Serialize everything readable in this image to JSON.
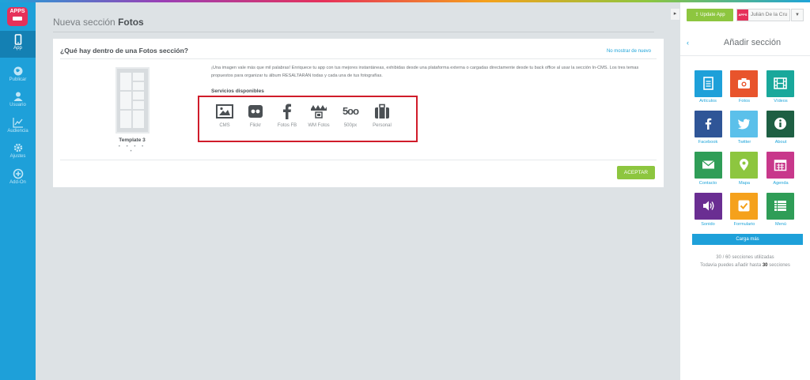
{
  "app": {
    "logo_text": "APPS",
    "accent": "#1ea0d9"
  },
  "sidebar": {
    "items": [
      {
        "label": "App",
        "icon": "mobile-icon"
      },
      {
        "label": "Publicar",
        "icon": "globe-icon"
      },
      {
        "label": "Usuario",
        "icon": "user-icon"
      },
      {
        "label": "Audiencia",
        "icon": "chart-icon"
      },
      {
        "label": "Ajustes",
        "icon": "gear-icon"
      },
      {
        "label": "Add-On",
        "icon": "plus-circle-icon"
      }
    ]
  },
  "main": {
    "title_prefix": "Nueva sección",
    "title_bold": "Fotos"
  },
  "card": {
    "title": "¿Qué hay dentro de una Fotos sección?",
    "dismiss_link": "No mostrar de nuevo",
    "template_label": "Template 3",
    "template_dots": "• • • • •",
    "description": "¡Una imagen vale más que mil palabras! Enriquece tu app con tus mejores instantáneas, exhibidas desde una plataforma externa o cargadas directamente desde tu back office al usar la sección In-CMS. Los tres temas propuestos para organizar tu álbum RESALTARÁN todas y cada una de tus fotografías.",
    "services_title": "Servicios disponibles",
    "services": [
      {
        "label": "CMS",
        "icon": "image-icon"
      },
      {
        "label": "Flickr",
        "icon": "flickr-icon"
      },
      {
        "label": "Fotos FB",
        "icon": "facebook-icon"
      },
      {
        "label": "WM Fotos",
        "icon": "wm-fotos-icon"
      },
      {
        "label": "500px",
        "icon": "500px-icon",
        "glyph": "5oo"
      },
      {
        "label": "Personal",
        "icon": "briefcase-icon"
      }
    ],
    "accept_label": "ACEPTAR",
    "highlight_color": "#d01c2a"
  },
  "right_panel": {
    "update_label": "Update App",
    "user_name": "Julián De la Cru",
    "avatar_text": "APPS",
    "title": "Añadir sección",
    "tiles": [
      {
        "label": "Artículos",
        "color": "#1ea0d9",
        "icon": "document-icon"
      },
      {
        "label": "Fotos",
        "color": "#e8542c",
        "icon": "camera-icon"
      },
      {
        "label": "Vídeos",
        "color": "#19a89b",
        "icon": "film-icon"
      },
      {
        "label": "Facebook",
        "color": "#2f5597",
        "icon": "facebook-icon"
      },
      {
        "label": "Twitter",
        "color": "#5bc0ea",
        "icon": "twitter-icon"
      },
      {
        "label": "About",
        "color": "#1e5f43",
        "icon": "info-icon"
      },
      {
        "label": "Contacto",
        "color": "#2f9d57",
        "icon": "mail-icon"
      },
      {
        "label": "Mapa",
        "color": "#8dc63f",
        "icon": "map-pin-icon"
      },
      {
        "label": "Agenda",
        "color": "#c8388b",
        "icon": "calendar-icon"
      },
      {
        "label": "Sonido",
        "color": "#6a2e92",
        "icon": "speaker-icon"
      },
      {
        "label": "Formulario",
        "color": "#f5a11c",
        "icon": "checkbox-icon"
      },
      {
        "label": "Menú",
        "color": "#2f9d57",
        "icon": "list-icon"
      }
    ],
    "load_more": "Carga más",
    "usage_line": "30 / 60 secciones utilizadas",
    "remaining_prefix": "Todavía puedes añadir hasta",
    "remaining_count": "30",
    "remaining_suffix": "secciones"
  }
}
